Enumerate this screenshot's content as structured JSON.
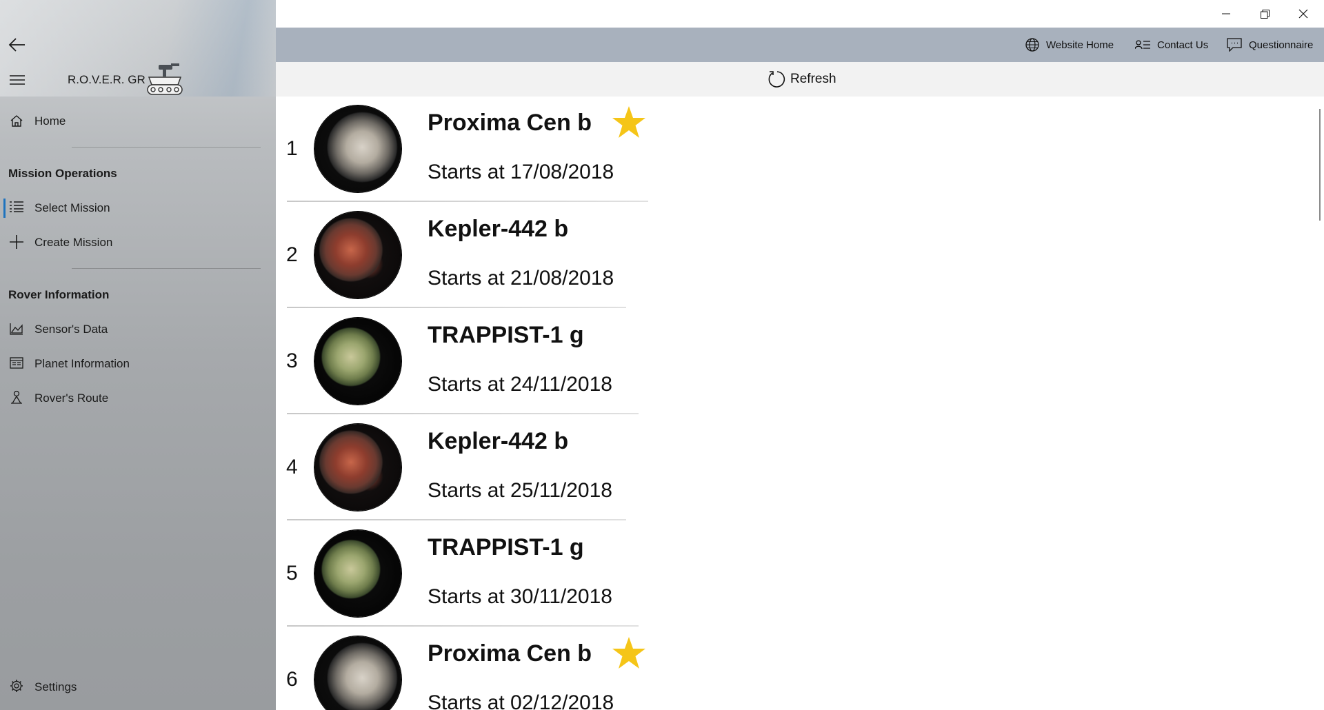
{
  "app": {
    "title": "R.O.V.E.R. GR"
  },
  "sidebar": {
    "home_label": "Home",
    "sections": [
      {
        "title": "Mission Operations",
        "items": [
          {
            "label": "Select Mission",
            "icon": "list-icon",
            "selected": true
          },
          {
            "label": "Create Mission",
            "icon": "plus-icon",
            "selected": false
          }
        ]
      },
      {
        "title": "Rover Information",
        "items": [
          {
            "label": "Sensor's Data",
            "icon": "area-chart-icon"
          },
          {
            "label": "Planet Information",
            "icon": "info-card-icon"
          },
          {
            "label": "Rover's Route",
            "icon": "route-icon"
          }
        ]
      }
    ],
    "settings_label": "Settings"
  },
  "appbar": {
    "website_home": "Website Home",
    "contact_us": "Contact Us",
    "questionnaire": "Questionnaire"
  },
  "refresh_label": "Refresh",
  "missions": [
    {
      "index": "1",
      "name": "Proxima Cen b",
      "date": "Starts at 17/08/2018",
      "starred": true,
      "planet": "proxima"
    },
    {
      "index": "2",
      "name": "Kepler-442 b",
      "date": "Starts at 21/08/2018",
      "starred": false,
      "planet": "kepler"
    },
    {
      "index": "3",
      "name": "TRAPPIST-1 g",
      "date": "Starts at 24/11/2018",
      "starred": false,
      "planet": "trappist"
    },
    {
      "index": "4",
      "name": "Kepler-442 b",
      "date": "Starts at 25/11/2018",
      "starred": false,
      "planet": "kepler"
    },
    {
      "index": "5",
      "name": "TRAPPIST-1 g",
      "date": "Starts at 30/11/2018",
      "starred": false,
      "planet": "trappist"
    },
    {
      "index": "6",
      "name": "Proxima Cen b",
      "date": "Starts at 02/12/2018",
      "starred": true,
      "planet": "proxima"
    }
  ],
  "colors": {
    "accent": "#1e73be",
    "star": "#f5c518",
    "appbar": "#a8b1bd"
  }
}
